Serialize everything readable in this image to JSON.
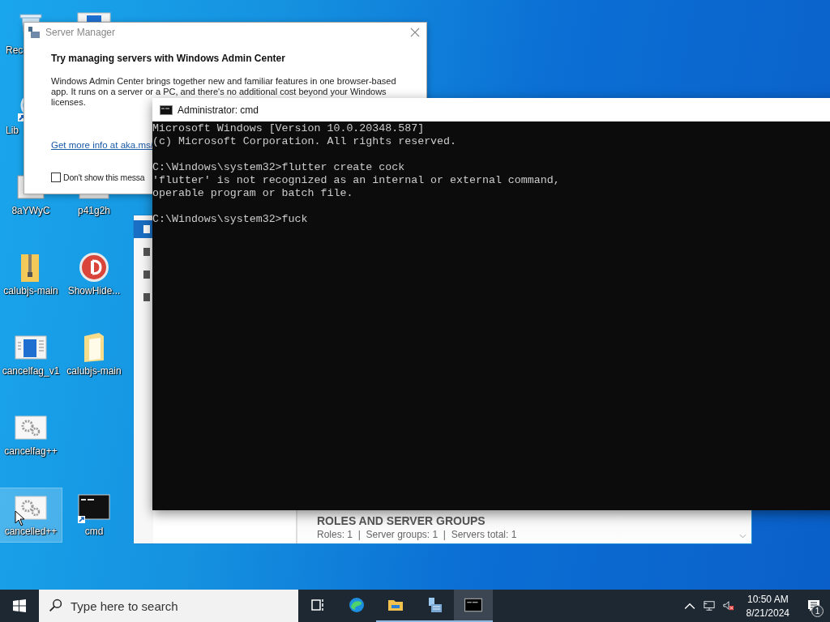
{
  "desktop_icons": [
    {
      "label": "Rec",
      "kind": "recycle-bin",
      "selected": false
    },
    {
      "kind": "window-corner",
      "selected": false
    },
    {
      "label": "Lib",
      "kind": "shortcut-ring",
      "selected": false
    },
    {
      "label": "8aYWyC",
      "kind": "image-file",
      "selected": false
    },
    {
      "label": "p41g2h",
      "kind": "window-file",
      "selected": false
    },
    {
      "label": "calubjs-main",
      "kind": "zip-folder",
      "selected": false
    },
    {
      "label": "ShowHide...",
      "kind": "red-badge",
      "selected": false
    },
    {
      "label": "cancelfag_v1",
      "kind": "blue-window",
      "selected": false
    },
    {
      "label": "calubjs-main",
      "kind": "open-folder",
      "selected": false
    },
    {
      "label": "cancelfag++",
      "kind": "gear-window",
      "selected": false
    },
    {
      "label": "cancelled++",
      "kind": "gear-window",
      "selected": true
    },
    {
      "label": "cmd",
      "kind": "console",
      "selected": false
    }
  ],
  "server_manager": {
    "sidebar_items": [
      {
        "selected": true
      },
      {
        "selected": false
      },
      {
        "selected": false
      },
      {
        "selected": false
      }
    ],
    "section_title": "ROLES AND SERVER GROUPS",
    "section_summary": "Roles: 1  |  Server groups: 1  |  Servers total: 1"
  },
  "dialog": {
    "title": "Server Manager",
    "heading": "Try managing servers with Windows Admin Center",
    "body": "Windows Admin Center brings together new and familiar features in one browser-based app. It runs on a server or a PC, and there's no additional cost beyond your Windows licenses.",
    "link": "Get more info at aka.ms/",
    "checkbox": {
      "label": "Don't show this messa",
      "checked": false
    }
  },
  "console": {
    "title": "Administrator: cmd",
    "blocks": [
      [
        "Microsoft Windows [Version 10.0.20348.587]",
        "(c) Microsoft Corporation. All rights reserved."
      ],
      [
        "C:\\Windows\\system32>flutter create cock",
        "'flutter' is not recognized as an internal or external command,",
        "operable program or batch file."
      ],
      [
        "C:\\Windows\\system32>fuck"
      ]
    ]
  },
  "taskbar": {
    "search_placeholder": "Type here to search",
    "apps": [
      {
        "kind": "task-view",
        "running": false,
        "selected": false
      },
      {
        "kind": "browser",
        "running": false,
        "selected": false
      },
      {
        "kind": "file-explorer",
        "running": true,
        "selected": false
      },
      {
        "kind": "server-manager",
        "running": true,
        "selected": false
      },
      {
        "kind": "console",
        "running": true,
        "selected": true
      }
    ],
    "time": "10:50 AM",
    "date": "8/21/2024",
    "notification_count": "1"
  }
}
